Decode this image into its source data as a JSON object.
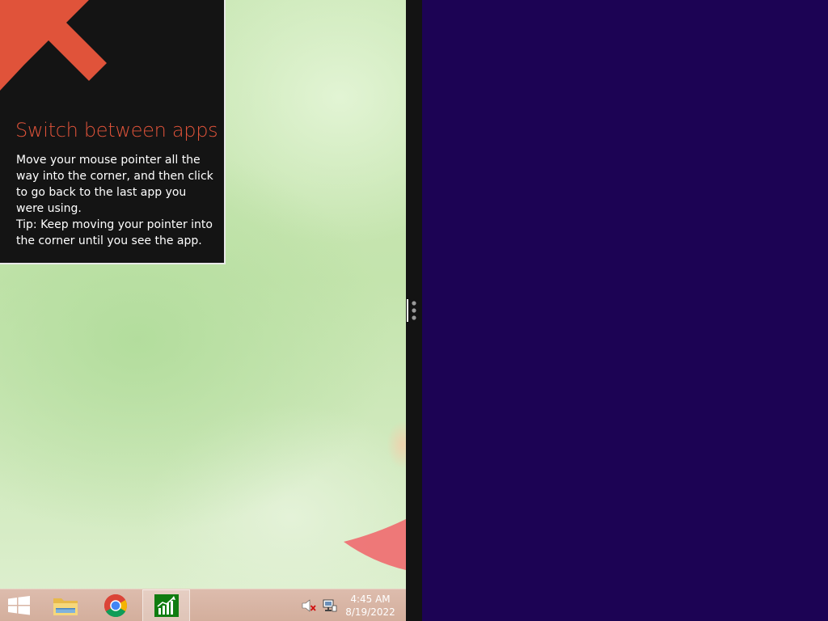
{
  "tip": {
    "title": "Switch between apps",
    "body_lines": [
      "Move your mouse pointer all the way into the corner, and then click to go back to the last app you were using.",
      "Tip: Keep moving your pointer into the corner until you see the app."
    ],
    "accent_color": "#e0533a",
    "arrow_icon": "arrow-up-left-icon"
  },
  "taskbar": {
    "items": [
      {
        "name": "start-button",
        "icon": "windows-logo-icon"
      },
      {
        "name": "file-explorer",
        "icon": "folder-icon"
      },
      {
        "name": "chrome",
        "icon": "chrome-icon"
      },
      {
        "name": "finance-app",
        "icon": "stock-chart-icon",
        "active": true
      }
    ],
    "tray": {
      "volume_icon": "speaker-muted-icon",
      "network_icon": "network-icon"
    },
    "clock": {
      "time": "4:45 AM",
      "date": "8/19/2022"
    }
  },
  "colors": {
    "right_pane_bg": "#1c0354",
    "divider": "#131313",
    "taskbar": "#d3ae9c"
  }
}
